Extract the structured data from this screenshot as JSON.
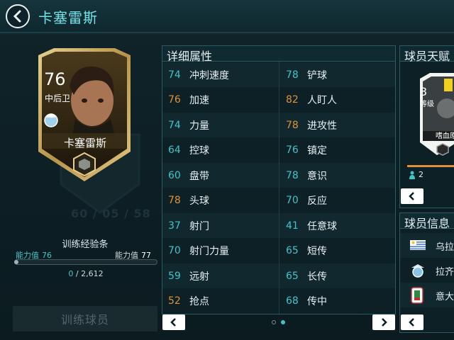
{
  "header": {
    "title": "卡塞雷斯"
  },
  "player_card": {
    "rating": "76",
    "position": "中后卫",
    "name": "卡塞雷斯",
    "shadow_text": "60 / 05 / 58"
  },
  "training": {
    "label": "训练经验条",
    "ability_label": "能力值",
    "ability_current": "76",
    "ability_next": "77",
    "xp_current": "0",
    "xp_separator": " / ",
    "xp_total": "2,612",
    "xp_progress": 0,
    "button_label": "训练球员"
  },
  "attributes": {
    "title": "详细属性",
    "rows": [
      {
        "lv": "74",
        "ln": "冲刺速度",
        "lc": "#3ec5c9",
        "rv": "78",
        "rn": "铲球",
        "rc": "#3ec5c9"
      },
      {
        "lv": "76",
        "ln": "加速",
        "lc": "#e0913b",
        "rv": "82",
        "rn": "人盯人",
        "rc": "#e0913b"
      },
      {
        "lv": "74",
        "ln": "力量",
        "lc": "#3ec5c9",
        "rv": "78",
        "rn": "进攻性",
        "rc": "#e0913b"
      },
      {
        "lv": "64",
        "ln": "控球",
        "lc": "#3ec5c9",
        "rv": "76",
        "rn": "镇定",
        "rc": "#3ec5c9"
      },
      {
        "lv": "60",
        "ln": "盘带",
        "lc": "#3ec5c9",
        "rv": "78",
        "rn": "意识",
        "rc": "#3ec5c9"
      },
      {
        "lv": "78",
        "ln": "头球",
        "lc": "#e0913b",
        "rv": "70",
        "rn": "反应",
        "rc": "#3ec5c9"
      },
      {
        "lv": "37",
        "ln": "射门",
        "lc": "#3ec5c9",
        "rv": "41",
        "rn": "任意球",
        "rc": "#3ec5c9"
      },
      {
        "lv": "70",
        "ln": "射门力量",
        "lc": "#3ec5c9",
        "rv": "65",
        "rn": "短传",
        "rc": "#3ec5c9"
      },
      {
        "lv": "59",
        "ln": "远射",
        "lc": "#3ec5c9",
        "rv": "65",
        "rn": "长传",
        "rc": "#3ec5c9"
      },
      {
        "lv": "52",
        "ln": "抢点",
        "lc": "#e0913b",
        "rv": "68",
        "rn": "传中",
        "rc": "#3ec5c9"
      }
    ]
  },
  "talents": {
    "title": "球员天赋",
    "level": "3",
    "level_label": "等级",
    "talent_name": "嗜血原",
    "count": "2"
  },
  "player_info": {
    "title": "球员信息",
    "rows": [
      {
        "text": "乌拉",
        "icon": "uruguay-flag-icon"
      },
      {
        "text": "拉齐",
        "icon": "lazio-badge-icon"
      },
      {
        "text": "意大",
        "icon": "serie-a-badge-icon"
      }
    ]
  },
  "colors": {
    "accent": "#6fe3e6",
    "high": "#e0913b",
    "normal": "#3ec5c9",
    "card_gold": "#c9a95a"
  }
}
